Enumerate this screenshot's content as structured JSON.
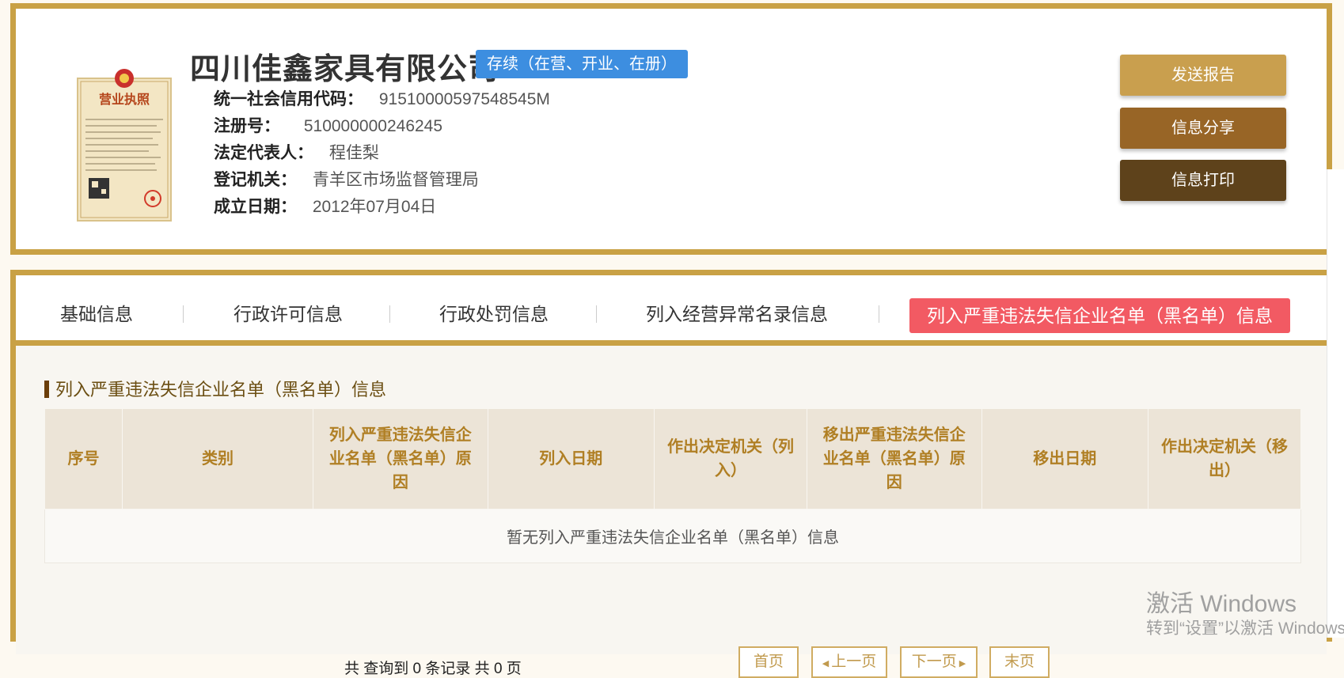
{
  "company": {
    "name": "四川佳鑫家具有限公司",
    "status": "存续（在营、开业、在册）",
    "license_image": {
      "title": "营业执照"
    },
    "info": [
      {
        "label": "统一社会信用代码：",
        "value": "91510000597548545M"
      },
      {
        "label": "注册号：",
        "value": "510000000246245"
      },
      {
        "label": "法定代表人：",
        "value": "程佳梨"
      },
      {
        "label": "登记机关：",
        "value": "青羊区市场监督管理局"
      },
      {
        "label": "成立日期：",
        "value": "2012年07月04日"
      }
    ]
  },
  "actions": {
    "send_report": "发送报告",
    "share": "信息分享",
    "print": "信息打印"
  },
  "colors": {
    "border_gold": "#c9a145",
    "btn_send": "#c99f4e",
    "btn_share": "#986526",
    "btn_print": "#5e421b",
    "badge_blue": "#3d8ee0",
    "active_tab": "#f25a63"
  },
  "tabs": [
    {
      "label": "基础信息"
    },
    {
      "label": "行政许可信息"
    },
    {
      "label": "行政处罚信息"
    },
    {
      "label": "列入经营异常名录信息"
    },
    {
      "label": "列入严重违法失信企业名单（黑名单）信息",
      "active": true
    }
  ],
  "section": {
    "title": "列入严重违法失信企业名单（黑名单）信息",
    "columns": [
      "序号",
      "类别",
      "列入严重违法失信企业名单（黑名单）原因",
      "列入日期",
      "作出决定机关（列入）",
      "移出严重违法失信企业名单（黑名单）原因",
      "移出日期",
      "作出决定机关（移出）"
    ],
    "empty_message": "暂无列入严重违法失信企业名单（黑名单）信息"
  },
  "pagination": {
    "summary": "共 查询到 0 条记录 共 0 页",
    "first": "首页",
    "prev": "上一页",
    "next": "下一页",
    "last": "末页"
  },
  "watermark": {
    "line1": "激活 Windows",
    "line2": "转到“设置”以激活 Windows。"
  }
}
